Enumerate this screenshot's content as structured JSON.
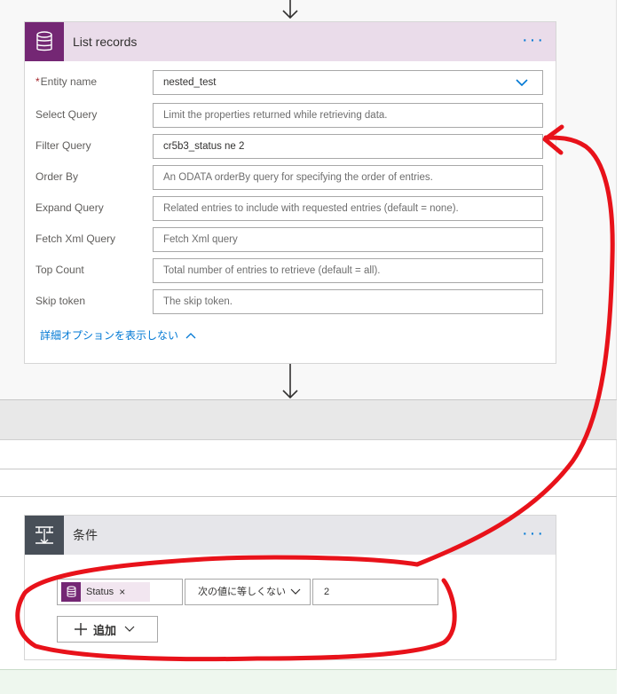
{
  "list_records": {
    "title": "List records",
    "menu": "···",
    "fields": [
      {
        "label": "Entity name",
        "required": true,
        "value": "nested_test",
        "placeholder": "",
        "type": "dropdown"
      },
      {
        "label": "Select Query",
        "required": false,
        "value": "",
        "placeholder": "Limit the properties returned while retrieving data."
      },
      {
        "label": "Filter Query",
        "required": false,
        "value": "cr5b3_status ne 2",
        "placeholder": ""
      },
      {
        "label": "Order By",
        "required": false,
        "value": "",
        "placeholder": "An ODATA orderBy query for specifying the order of entries."
      },
      {
        "label": "Expand Query",
        "required": false,
        "value": "",
        "placeholder": "Related entries to include with requested entries (default = none)."
      },
      {
        "label": "Fetch Xml Query",
        "required": false,
        "value": "",
        "placeholder": "Fetch Xml query"
      },
      {
        "label": "Top Count",
        "required": false,
        "value": "",
        "placeholder": "Total number of entries to retrieve (default = all)."
      },
      {
        "label": "Skip token",
        "required": false,
        "value": "",
        "placeholder": "The skip token."
      }
    ],
    "advanced_toggle": "詳細オプションを表示しない"
  },
  "condition": {
    "title": "条件",
    "menu": "···",
    "token_label": "Status",
    "token_close": "×",
    "operator": "次の値に等しくない",
    "value": "2",
    "add_label": "追加"
  },
  "colors": {
    "accent": "#0078d4",
    "dataverse_purple": "#742774",
    "list_header_bg": "#eadcea",
    "condition_icon_bg": "#484f58",
    "annotation_red": "#e8121a"
  },
  "icons": [
    "arrow-down-icon",
    "database-icon",
    "chevron-down-icon",
    "chevron-up-icon",
    "condition-icon",
    "plus-icon"
  ]
}
